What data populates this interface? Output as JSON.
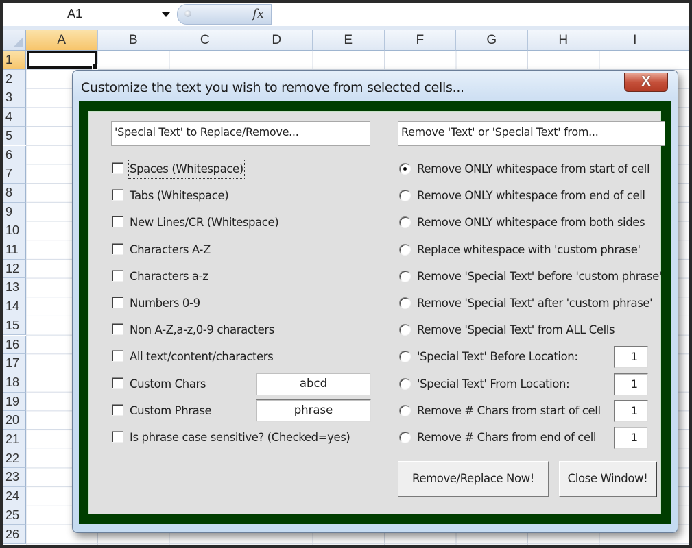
{
  "formula_bar": {
    "name_box": "A1",
    "fx_icon": "fx",
    "formula_value": ""
  },
  "sheet": {
    "columns": [
      "A",
      "B",
      "C",
      "D",
      "E",
      "F",
      "G",
      "H",
      "I"
    ],
    "rows": [
      "1",
      "2",
      "3",
      "4",
      "5",
      "6",
      "7",
      "8",
      "9",
      "10",
      "11",
      "12",
      "13",
      "14",
      "15",
      "16",
      "17",
      "18",
      "19",
      "20",
      "21",
      "22",
      "23",
      "24",
      "25",
      "26"
    ],
    "active_cell": "A1"
  },
  "dialog": {
    "title": "Customize the text you wish to remove from selected cells...",
    "close_icon": "x",
    "close_glyph": "X",
    "colors": {
      "frame": "#003d00",
      "panel": "#e0e0e0",
      "close": "#c5503a"
    },
    "left_header": "'Special Text' to Replace/Remove...",
    "right_header": "Remove 'Text' or  'Special Text' from...",
    "checkboxes": [
      {
        "label": "Spaces (Whitespace)",
        "checked": false,
        "focused": true
      },
      {
        "label": "Tabs (Whitespace)",
        "checked": false
      },
      {
        "label": "New Lines/CR (Whitespace)",
        "checked": false
      },
      {
        "label": "Characters A-Z",
        "checked": false
      },
      {
        "label": "Characters a-z",
        "checked": false
      },
      {
        "label": "Numbers 0-9",
        "checked": false
      },
      {
        "label": "Non A-Z,a-z,0-9 characters",
        "checked": false
      },
      {
        "label": "All text/content/characters",
        "checked": false
      },
      {
        "label": "Custom Chars",
        "checked": false,
        "input_value": "abcd"
      },
      {
        "label": "Custom Phrase",
        "checked": false,
        "input_value": "phrase"
      },
      {
        "label": "Is phrase case sensitive? (Checked=yes)",
        "checked": false
      }
    ],
    "radios": [
      {
        "label": "Remove ONLY whitespace from start of cell",
        "selected": true
      },
      {
        "label": "Remove ONLY whitespace from end of cell",
        "selected": false
      },
      {
        "label": "Remove ONLY whitespace from both sides",
        "selected": false
      },
      {
        "label": "Replace whitespace with 'custom phrase'",
        "selected": false
      },
      {
        "label": "Remove 'Special Text' before 'custom phrase'",
        "selected": false
      },
      {
        "label": "Remove 'Special Text' after 'custom phrase'",
        "selected": false
      },
      {
        "label": "Remove 'Special Text' from ALL Cells",
        "selected": false
      },
      {
        "label": "'Special Text' Before Location:",
        "selected": false,
        "input_value": "1"
      },
      {
        "label": "'Special Text' From Location:",
        "selected": false,
        "input_value": "1"
      },
      {
        "label": "Remove # Chars from start of cell",
        "selected": false,
        "input_value": "1"
      },
      {
        "label": "Remove # Chars from end of cell",
        "selected": false,
        "input_value": "1"
      }
    ],
    "buttons": {
      "apply": "Remove/Replace Now!",
      "close": "Close Window!"
    }
  }
}
